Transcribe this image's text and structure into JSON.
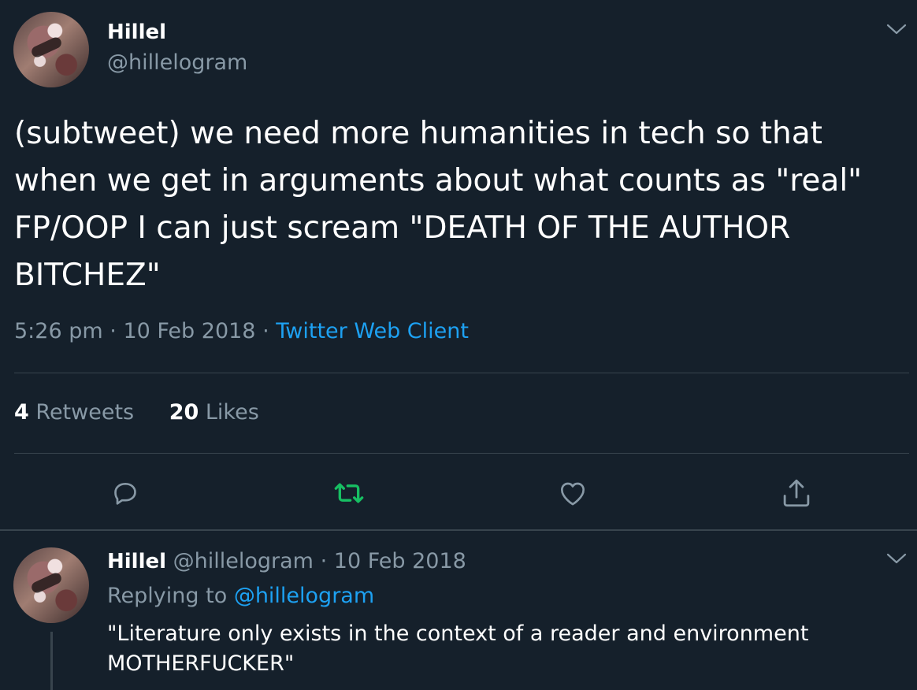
{
  "tweet": {
    "author_name": "Hillel",
    "author_handle": "@hillelogram",
    "text": "(subtweet) we need more humanities in tech so that when we get in arguments about what counts as \"real\" FP/OOP I can just scream \"DEATH OF THE AUTHOR BITCHEZ\"",
    "time": "5:26 pm",
    "date": "10 Feb 2018",
    "separator": "·",
    "client": "Twitter Web Client",
    "retweets_count": "4",
    "retweets_label": "Retweets",
    "likes_count": "20",
    "likes_label": "Likes"
  },
  "actions": [
    "reply-icon",
    "retweet-icon",
    "like-icon",
    "share-icon"
  ],
  "reply": {
    "author_name": "Hillel",
    "author_handle": "@hillelogram",
    "separator": "·",
    "date": "10 Feb 2018",
    "replying_label": "Replying to",
    "replying_to": "@hillelogram",
    "text": "\"Literature only exists in the context of a reader and environment MOTHERFUCKER\""
  },
  "colors": {
    "background": "#15202b",
    "text": "#ffffff",
    "secondary": "#8899a6",
    "link": "#1da1f2",
    "retweet_active": "#17bf63",
    "divider": "#38444d"
  }
}
